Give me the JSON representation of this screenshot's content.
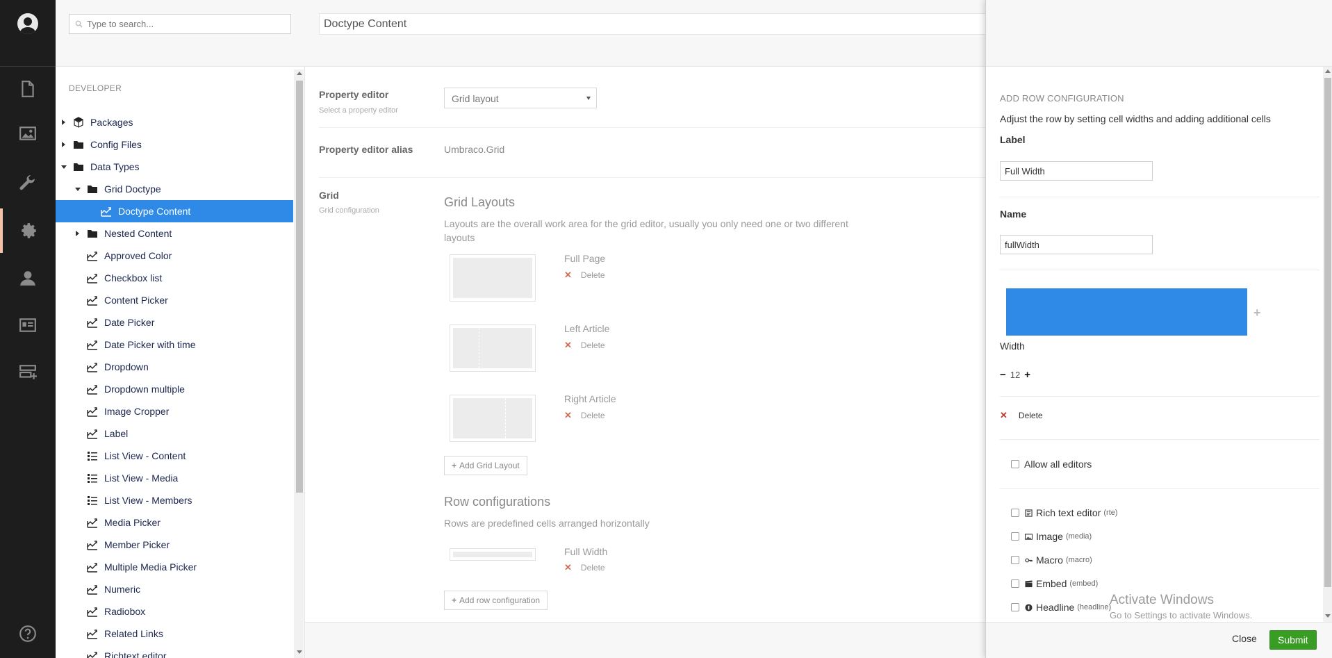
{
  "appbar": {
    "sections": [
      {
        "name": "content",
        "icon": "document-icon"
      },
      {
        "name": "media",
        "icon": "image-icon"
      },
      {
        "name": "settings",
        "icon": "wrench-icon"
      },
      {
        "name": "developer",
        "icon": "gear-icon",
        "active": true
      },
      {
        "name": "users",
        "icon": "user-icon"
      },
      {
        "name": "members",
        "icon": "id-card-icon"
      },
      {
        "name": "forms",
        "icon": "server-add-icon"
      }
    ],
    "help_icon": "help-icon"
  },
  "tree": {
    "search_placeholder": "Type to search...",
    "heading": "DEVELOPER",
    "items": [
      {
        "label": "Packages",
        "icon": "package-icon",
        "arrow": "right",
        "level": 0
      },
      {
        "label": "Config Files",
        "icon": "folder-icon",
        "arrow": "right",
        "level": 0
      },
      {
        "label": "Data Types",
        "icon": "folder-icon",
        "arrow": "down",
        "level": 0
      },
      {
        "label": "Grid Doctype",
        "icon": "folder-icon",
        "arrow": "down",
        "level": 1
      },
      {
        "label": "Doctype Content",
        "icon": "datatype-icon",
        "arrow": "",
        "level": 2,
        "selected": true
      },
      {
        "label": "Nested Content",
        "icon": "folder-icon",
        "arrow": "right",
        "level": 1
      },
      {
        "label": "Approved Color",
        "icon": "datatype-icon",
        "arrow": "",
        "level": 1
      },
      {
        "label": "Checkbox list",
        "icon": "datatype-icon",
        "arrow": "",
        "level": 1
      },
      {
        "label": "Content Picker",
        "icon": "datatype-icon",
        "arrow": "",
        "level": 1
      },
      {
        "label": "Date Picker",
        "icon": "datatype-icon",
        "arrow": "",
        "level": 1
      },
      {
        "label": "Date Picker with time",
        "icon": "datatype-icon",
        "arrow": "",
        "level": 1
      },
      {
        "label": "Dropdown",
        "icon": "datatype-icon",
        "arrow": "",
        "level": 1
      },
      {
        "label": "Dropdown multiple",
        "icon": "datatype-icon",
        "arrow": "",
        "level": 1
      },
      {
        "label": "Image Cropper",
        "icon": "datatype-icon",
        "arrow": "",
        "level": 1
      },
      {
        "label": "Label",
        "icon": "datatype-icon",
        "arrow": "",
        "level": 1
      },
      {
        "label": "List View - Content",
        "icon": "listview-icon",
        "arrow": "",
        "level": 1
      },
      {
        "label": "List View - Media",
        "icon": "listview-icon",
        "arrow": "",
        "level": 1
      },
      {
        "label": "List View - Members",
        "icon": "listview-icon",
        "arrow": "",
        "level": 1
      },
      {
        "label": "Media Picker",
        "icon": "datatype-icon",
        "arrow": "",
        "level": 1
      },
      {
        "label": "Member Picker",
        "icon": "datatype-icon",
        "arrow": "",
        "level": 1
      },
      {
        "label": "Multiple Media Picker",
        "icon": "datatype-icon",
        "arrow": "",
        "level": 1
      },
      {
        "label": "Numeric",
        "icon": "datatype-icon",
        "arrow": "",
        "level": 1
      },
      {
        "label": "Radiobox",
        "icon": "datatype-icon",
        "arrow": "",
        "level": 1
      },
      {
        "label": "Related Links",
        "icon": "datatype-icon",
        "arrow": "",
        "level": 1
      },
      {
        "label": "Richtext editor",
        "icon": "datatype-icon",
        "arrow": "",
        "level": 1
      }
    ]
  },
  "editor": {
    "name": "Doctype Content",
    "property_editor_label": "Property editor",
    "property_editor_desc": "Select a property editor",
    "property_editor_value": "Grid layout",
    "alias_label": "Property editor alias",
    "alias_value": "Umbraco.Grid",
    "grid_label": "Grid",
    "grid_desc": "Grid configuration",
    "layouts_title": "Grid Layouts",
    "layouts_desc": "Layouts are the overall work area for the grid editor, usually you only need one or two different layouts",
    "layouts": [
      {
        "name": "Full Page",
        "delete": "Delete"
      },
      {
        "name": "Left Article",
        "delete": "Delete"
      },
      {
        "name": "Right Article",
        "delete": "Delete"
      }
    ],
    "add_layout": "Add Grid Layout",
    "rows_title": "Row configurations",
    "rows_desc": "Rows are predefined cells arranged horizontally",
    "rows": [
      {
        "name": "Full Width",
        "delete": "Delete"
      }
    ],
    "add_row": "Add row configuration"
  },
  "dialog": {
    "title": "ADD ROW CONFIGURATION",
    "subtitle": "Adjust the row by setting cell widths and adding additional cells",
    "label_label": "Label",
    "label_value": "Full Width",
    "name_label": "Name",
    "name_value": "fullWidth",
    "cell_color": "#2e8ae6",
    "add_cell": "+",
    "width_label": "Width",
    "width_minus": "−",
    "width_value": "12",
    "width_plus": "+",
    "delete_label": "Delete",
    "allow_all": "Allow all editors",
    "editors": [
      {
        "name": "Rich text editor",
        "alias": "(rte)",
        "icon": "rte-icon"
      },
      {
        "name": "Image",
        "alias": "(media)",
        "icon": "picture-icon"
      },
      {
        "name": "Macro",
        "alias": "(macro)",
        "icon": "key-icon"
      },
      {
        "name": "Embed",
        "alias": "(embed)",
        "icon": "movie-icon"
      },
      {
        "name": "Headline",
        "alias": "(headline)",
        "icon": "headline-icon"
      }
    ],
    "close": "Close",
    "submit": "Submit"
  },
  "watermark": {
    "line1": "Activate Windows",
    "line2": "Go to Settings to activate Windows."
  },
  "colors": {
    "appbar": "#1d1d1d",
    "selected": "#2e8ae6",
    "submit": "#3a9d23",
    "active_section_indicator": "#f5c1a7"
  }
}
